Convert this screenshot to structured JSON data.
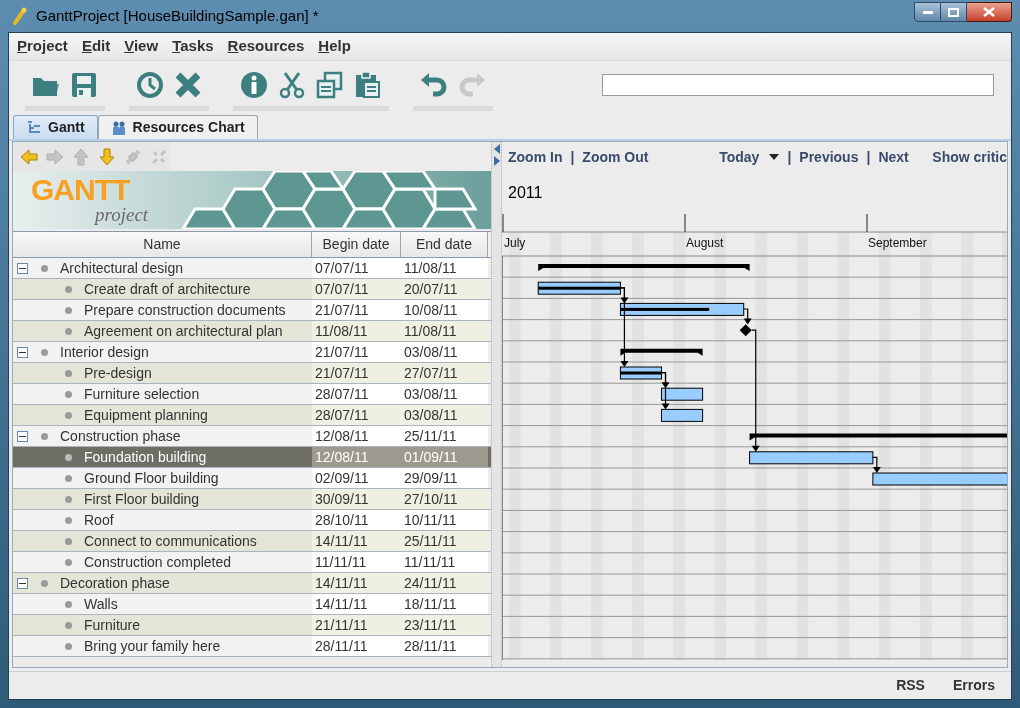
{
  "window": {
    "title": "GanttProject [HouseBuildingSample.gan] *"
  },
  "menu": [
    "Project",
    "Edit",
    "View",
    "Tasks",
    "Resources",
    "Help"
  ],
  "toolbar": [
    [
      {
        "kind": "open",
        "disabled": false
      },
      {
        "kind": "save",
        "disabled": false
      }
    ],
    [
      {
        "kind": "clock",
        "disabled": false
      },
      {
        "kind": "delete",
        "disabled": false
      }
    ],
    [
      {
        "kind": "info",
        "disabled": false
      },
      {
        "kind": "cut",
        "disabled": false
      },
      {
        "kind": "copy",
        "disabled": false
      },
      {
        "kind": "paste",
        "disabled": false
      }
    ],
    [
      {
        "kind": "undo",
        "disabled": false
      },
      {
        "kind": "redo",
        "disabled": true
      }
    ]
  ],
  "tabs": [
    {
      "label": "Gantt",
      "kind": "gantt",
      "selected": true
    },
    {
      "label": "Resources Chart",
      "kind": "people",
      "selected": false
    }
  ],
  "task_toolbar": [
    {
      "kind": "left",
      "disabled": false
    },
    {
      "kind": "right",
      "disabled": true
    },
    {
      "kind": "up",
      "disabled": true
    },
    {
      "kind": "down",
      "disabled": false
    },
    {
      "kind": "link",
      "disabled": true
    },
    {
      "kind": "unlink",
      "disabled": true
    }
  ],
  "logo": {
    "title": "GANTT",
    "subtitle": "project"
  },
  "table": {
    "columns": [
      "Name",
      "Begin date",
      "End date"
    ],
    "rows": [
      {
        "kind": "group",
        "name": "Architectural design",
        "begin": "07/07/11",
        "end": "11/08/11",
        "expanded": true,
        "selected": false,
        "children": [
          {
            "kind": "task",
            "name": "Create draft of architecture",
            "begin": "07/07/11",
            "end": "20/07/11",
            "level": 1,
            "selected": false
          },
          {
            "kind": "task",
            "name": "Prepare construction documents",
            "begin": "21/07/11",
            "end": "10/08/11",
            "level": 0.72,
            "selected": false
          },
          {
            "kind": "milestone",
            "name": "Agreement on architectural plan",
            "begin": "11/08/11",
            "end": "11/08/11",
            "selected": false
          }
        ]
      },
      {
        "kind": "group",
        "name": "Interior design",
        "begin": "21/07/11",
        "end": "03/08/11",
        "expanded": true,
        "selected": false,
        "children": [
          {
            "kind": "task",
            "name": "Pre-design",
            "begin": "21/07/11",
            "end": "27/07/11",
            "level": 1,
            "selected": false
          },
          {
            "kind": "task",
            "name": "Furniture selection",
            "begin": "28/07/11",
            "end": "03/08/11",
            "selected": false
          },
          {
            "kind": "task",
            "name": "Equipment planning",
            "begin": "28/07/11",
            "end": "03/08/11",
            "selected": false
          }
        ]
      },
      {
        "kind": "group",
        "name": "Construction phase",
        "begin": "12/08/11",
        "end": "25/11/11",
        "expanded": true,
        "selected": false,
        "children": [
          {
            "kind": "task",
            "name": "Foundation building",
            "begin": "12/08/11",
            "end": "01/09/11",
            "selected": true
          },
          {
            "kind": "task",
            "name": "Ground Floor building",
            "begin": "02/09/11",
            "end": "29/09/11",
            "selected": false
          },
          {
            "kind": "task",
            "name": "First Floor building",
            "begin": "30/09/11",
            "end": "27/10/11",
            "selected": false
          },
          {
            "kind": "task",
            "name": "Roof",
            "begin": "28/10/11",
            "end": "10/11/11",
            "selected": false
          },
          {
            "kind": "task",
            "name": "Connect to communications",
            "begin": "14/11/11",
            "end": "25/11/11",
            "selected": false
          },
          {
            "kind": "milestone",
            "name": "Construction completed",
            "begin": "11/11/11",
            "end": "11/11/11",
            "selected": false
          }
        ]
      },
      {
        "kind": "group",
        "name": "Decoration phase",
        "begin": "14/11/11",
        "end": "24/11/11",
        "expanded": true,
        "selected": false,
        "children": [
          {
            "kind": "task",
            "name": "Walls",
            "begin": "14/11/11",
            "end": "18/11/11",
            "selected": false
          },
          {
            "kind": "task",
            "name": "Furniture",
            "begin": "21/11/11",
            "end": "23/11/11",
            "selected": false
          },
          {
            "kind": "task",
            "name": "Bring your family here",
            "begin": "28/11/11",
            "end": "28/11/11",
            "selected": false
          }
        ]
      }
    ]
  },
  "chart_toolbar": [
    {
      "kind": "link",
      "label": "Zoom In"
    },
    {
      "kind": "separator",
      "label": "|"
    },
    {
      "kind": "link",
      "label": "Zoom Out"
    },
    {
      "kind": "spacer"
    },
    {
      "kind": "dropdown",
      "label": "Today"
    },
    {
      "kind": "separator",
      "label": "|"
    },
    {
      "kind": "link",
      "label": "Previous"
    },
    {
      "kind": "separator",
      "label": "|"
    },
    {
      "kind": "link",
      "label": "Next"
    },
    {
      "kind": "spacer_small"
    },
    {
      "kind": "link",
      "label": "Show critic"
    }
  ],
  "timeline": {
    "year": "2011",
    "months": [
      "July",
      "August",
      "September"
    ]
  },
  "status_bar": [
    "RSS",
    "Errors"
  ]
}
